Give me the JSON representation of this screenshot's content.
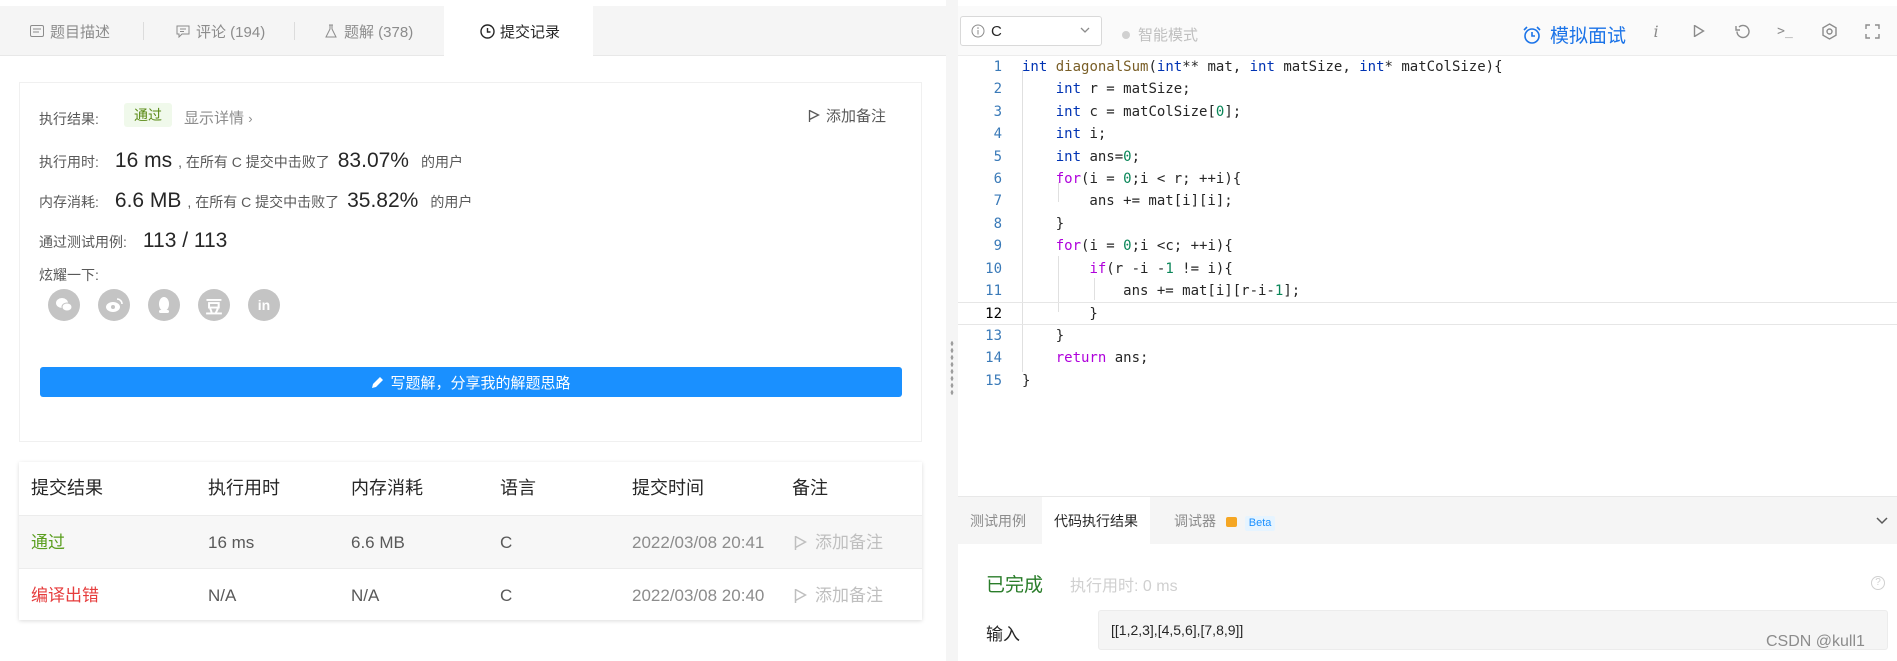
{
  "tabs": [
    {
      "label": "题目描述"
    },
    {
      "label": "评论 (194)"
    },
    {
      "label": "题解 (378)"
    },
    {
      "label": "提交记录"
    }
  ],
  "result": {
    "exec_result_label": "执行结果:",
    "status": "通过",
    "show_detail": "显示详情",
    "add_note": "添加备注",
    "runtime_label": "执行用时:",
    "runtime_value": "16 ms",
    "runtime_prefix": ", 在所有 C 提交中击败了",
    "runtime_percent": "83.07%",
    "users_suffix": "的用户",
    "memory_label": "内存消耗:",
    "memory_value": "6.6 MB",
    "memory_prefix": ", 在所有 C 提交中击败了",
    "memory_percent": "35.82%",
    "tests_label": "通过测试用例:",
    "tests_value": "113 / 113",
    "share_label": "炫耀一下:",
    "share_icons": [
      "wechat-icon",
      "weibo-icon",
      "qq-icon",
      "douban-icon",
      "linkedin-icon"
    ],
    "write_solution": "写题解，分享我的解题思路"
  },
  "history": {
    "headers": [
      "提交结果",
      "执行用时",
      "内存消耗",
      "语言",
      "提交时间",
      "备注"
    ],
    "rows": [
      {
        "result": "通过",
        "time": "16 ms",
        "memory": "6.6 MB",
        "lang": "C",
        "submitted": "2022/03/08 20:41",
        "note": "添加备注"
      },
      {
        "result": "编译出错",
        "time": "N/A",
        "memory": "N/A",
        "lang": "C",
        "submitted": "2022/03/08 20:40",
        "note": "添加备注"
      }
    ]
  },
  "toolbar": {
    "language": "C",
    "smart_mode": "智能模式",
    "mock_interview": "模拟面试",
    "icons": [
      "info-icon",
      "run-icon",
      "reset-icon",
      "terminal-icon",
      "settings-icon",
      "fullscreen-icon"
    ]
  },
  "code": {
    "lines": [
      "int diagonalSum(int** mat, int matSize, int* matColSize){",
      "    int r = matSize;",
      "    int c = matColSize[0];",
      "    int i;",
      "    int ans=0;",
      "    for(i = 0;i < r; ++i){",
      "        ans += mat[i][i];",
      "    }",
      "    for(i = 0;i <c; ++i){",
      "        if(r -i -1 != i){",
      "            ans += mat[i][r-i-1];",
      "        }",
      "    }",
      "    return ans;",
      "}"
    ],
    "active_line": 12
  },
  "console": {
    "tabs": [
      "测试用例",
      "代码执行结果",
      "调试器"
    ],
    "beta": "Beta",
    "status": "已完成",
    "exec_time": "执行用时: 0 ms",
    "input_label": "输入",
    "input_value": "[[1,2,3],[4,5,6],[7,8,9]]"
  },
  "watermark": "CSDN @kull1",
  "colors": {
    "accent": "#1a90ff",
    "pass": "#5a9e1e",
    "fail": "#e63c3c"
  }
}
